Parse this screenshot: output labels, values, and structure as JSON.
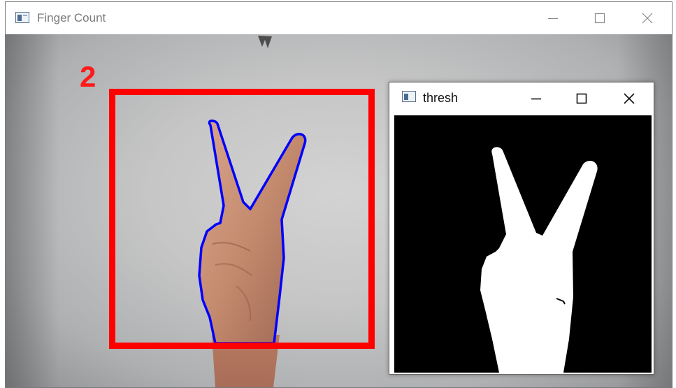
{
  "main_window": {
    "title": "Finger Count",
    "icon": "opencv-window-icon",
    "controls": [
      "minimize-icon",
      "maximize-icon",
      "close-icon"
    ]
  },
  "overlay": {
    "finger_count": "2",
    "roi_color": "#ff0000",
    "contour_color": "#0000ff"
  },
  "thresh_window": {
    "title": "thresh",
    "icon": "opencv-window-icon",
    "controls": [
      "minimize-icon",
      "maximize-icon",
      "close-icon"
    ],
    "foreground_color": "#ffffff",
    "background_color": "#000000"
  }
}
